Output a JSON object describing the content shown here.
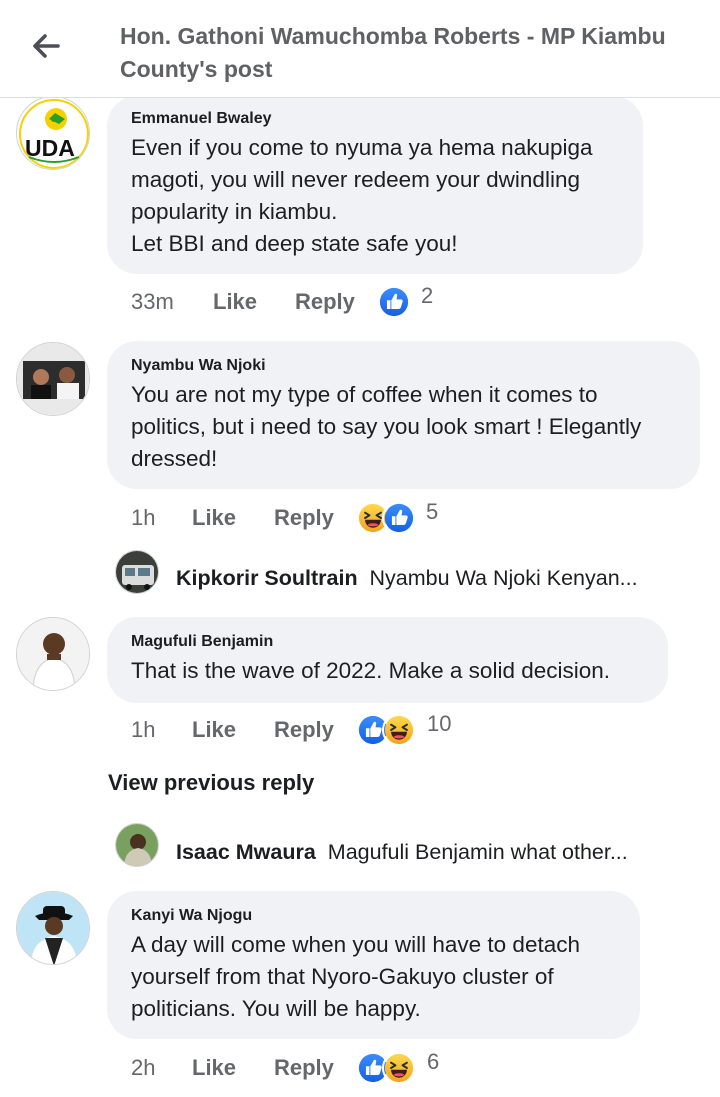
{
  "header": {
    "title": "Hon. Gathoni Wamuchomba Roberts - MP Kiambu County's post"
  },
  "comments": [
    {
      "author": "Emmanuel Bwaley",
      "text": "Even if you come to nyuma ya hema nakupiga\nmagoti, you will never redeem your dwindling\npopularity in kiambu.\nLet BBI and deep state safe you!",
      "avatar_text": "UDA",
      "time": "33m",
      "like_label": "Like",
      "reply_label": "Reply",
      "reactions": [
        "like-reaction-icon"
      ],
      "reaction_count": "2"
    },
    {
      "author": "Nyambu Wa Njoki",
      "text": "You are not my type of coffee when it comes to\npolitics, but i need to say you look smart ! Elegantly\ndressed!",
      "time": "1h",
      "like_label": "Like",
      "reply_label": "Reply",
      "reactions": [
        "haha-reaction-icon",
        "like-reaction-icon"
      ],
      "reaction_count": "5",
      "reply_preview": {
        "author": "Kipkorir Soultrain",
        "text": "Nyambu Wa Njoki Kenyan..."
      }
    },
    {
      "author": "Magufuli Benjamin",
      "text": "That is the wave of 2022. Make a solid decision.",
      "time": "1h",
      "like_label": "Like",
      "reply_label": "Reply",
      "reactions": [
        "like-reaction-icon",
        "haha-reaction-icon"
      ],
      "reaction_count": "10",
      "view_previous_label": "View previous reply",
      "reply_preview": {
        "author": "Isaac Mwaura",
        "text": "Magufuli Benjamin what other..."
      }
    },
    {
      "author": "Kanyi Wa Njogu",
      "text": "A day will come when you will have to detach\nyourself from that Nyoro-Gakuyo cluster of\npoliticians. You will be happy.",
      "time": "2h",
      "like_label": "Like",
      "reply_label": "Reply",
      "reactions": [
        "like-reaction-icon",
        "haha-reaction-icon"
      ],
      "reaction_count": "6"
    }
  ],
  "colors": {
    "like_blue": "#1877f2",
    "haha_yellow": "#f7b125",
    "bubble_bg": "#f0f2f5",
    "meta_gray": "#65676b"
  }
}
